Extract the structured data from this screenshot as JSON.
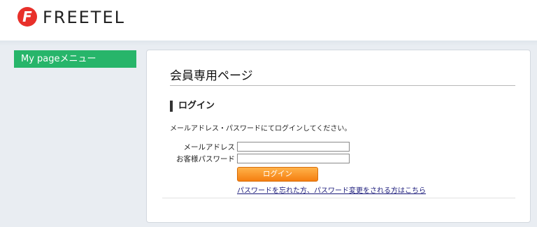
{
  "brand": {
    "name": "FREETEL",
    "logo_letter": "F",
    "accent_color": "#e8302a"
  },
  "sidebar": {
    "menu_label": "My pageメニュー",
    "color": "#27b56a"
  },
  "main": {
    "page_title": "会員専用ページ",
    "section_title": "ログイン",
    "description": "メールアドレス・パスワードにてログインしてください。",
    "form": {
      "email_label": "メールアドレス",
      "email_value": "",
      "password_label": "お客様パスワード",
      "password_value": "",
      "login_button": "ログイン",
      "forgot_link": "パスワードを忘れた方、パスワード変更をされる方はこちら"
    }
  },
  "icons": [
    "freetel-logo-icon"
  ]
}
